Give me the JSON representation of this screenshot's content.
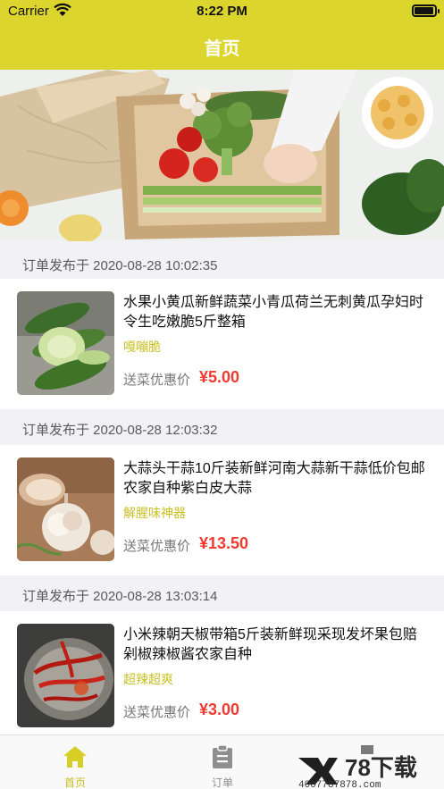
{
  "status_bar": {
    "carrier": "Carrier",
    "time": "8:22 PM"
  },
  "nav": {
    "title": "首页"
  },
  "orders": [
    {
      "header": "订单发布于 2020-08-28 10:02:35",
      "name": "水果小黄瓜新鲜蔬菜小青瓜荷兰无刺黄瓜孕妇时令生吃嫩脆5斤整箱",
      "tag": "嘎嘣脆",
      "price_label": "送菜优惠价",
      "price": "¥5.00",
      "image": "cucumber-photo"
    },
    {
      "header": "订单发布于 2020-08-28 12:03:32",
      "name": "大蒜头干蒜10斤装新鲜河南大蒜新干蒜低价包邮农家自种紫白皮大蒜",
      "tag": "解腥味神器",
      "price_label": "送菜优惠价",
      "price": "¥13.50",
      "image": "garlic-photo"
    },
    {
      "header": "订单发布于 2020-08-28 13:03:14",
      "name": "小米辣朝天椒带箱5斤装新鲜现采现发坏果包赔剁椒辣椒酱农家自种",
      "tag": "超辣超爽",
      "price_label": "送菜优惠价",
      "price": "¥3.00",
      "image": "chili-photo"
    }
  ],
  "tabs": [
    {
      "label": "首页",
      "icon": "home-icon",
      "active": true
    },
    {
      "label": "订单",
      "icon": "clipboard-icon",
      "active": false
    }
  ],
  "watermark": {
    "brand": "78下载",
    "url": "4007787878.com"
  },
  "colors": {
    "accent": "#dcd52e",
    "price": "#f13a2f",
    "tag": "#c9c024"
  }
}
